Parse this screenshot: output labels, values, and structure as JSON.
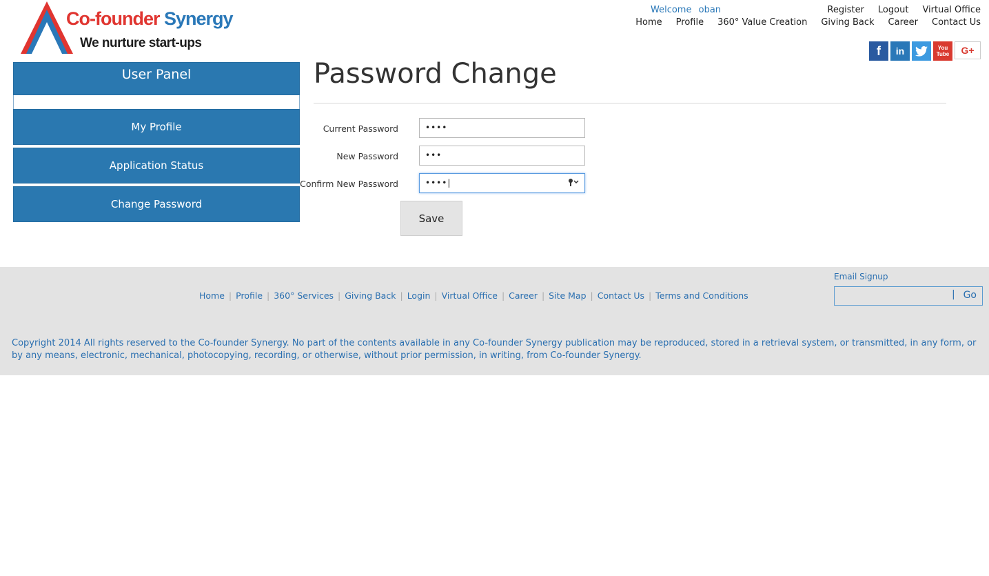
{
  "logo": {
    "title_part1": "Co-founder",
    "title_part2": "Synergy",
    "tagline": "We nurture start-ups"
  },
  "header": {
    "welcome_label": "Welcome",
    "welcome_user": "oban",
    "row1": [
      "Register",
      "Logout",
      "Virtual Office"
    ],
    "row2": [
      "Home",
      "Profile",
      "360° Value Creation",
      "Giving Back",
      "Career",
      "Contact Us"
    ]
  },
  "social": {
    "facebook": "f",
    "linkedin": "in",
    "twitter": "t",
    "youtube_line1": "You",
    "youtube_line2": "Tube",
    "googleplus": "G+"
  },
  "sidebar": {
    "title": "User Panel",
    "items": [
      {
        "label": "My Profile"
      },
      {
        "label": "Application Status"
      },
      {
        "label": "Change Password"
      }
    ]
  },
  "main": {
    "title": "Password Change",
    "fields": [
      {
        "label": "Current Password",
        "value": "••••"
      },
      {
        "label": "New Password",
        "value": "•••"
      },
      {
        "label": "Confirm New Password",
        "value": "••••"
      }
    ],
    "save_label": "Save"
  },
  "footer": {
    "links": [
      "Home",
      "Profile",
      "360° Services",
      "Giving Back",
      "Login",
      "Virtual Office",
      "Career",
      "Site Map",
      "Contact Us",
      "Terms and Conditions"
    ],
    "signup_label": "Email Signup",
    "go_label": "Go",
    "copyright": "Copyright 2014 All rights reserved to the Co-founder Synergy. No part of the contents available in any Co-founder Synergy publication may be reproduced, stored in a retrieval system, or transmitted, in any form, or by any means, electronic, mechanical, photocopying, recording, or otherwise, without prior permission, in writing, from Co-founder Synergy."
  }
}
